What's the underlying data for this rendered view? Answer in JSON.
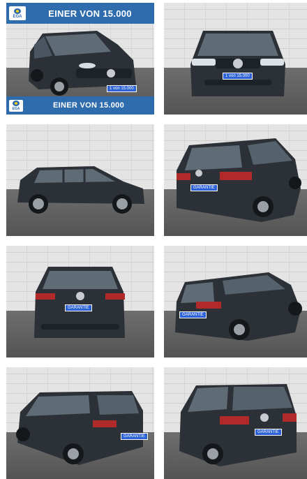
{
  "gallery": {
    "banner_top": "EINER VON 15.000",
    "banner_bottom": "EINER VON 15.000",
    "badge": "EGA",
    "plate_front": "1 von 15.000",
    "plate_rear": "GARANTIE",
    "colors": {
      "banner": "#2f6cae",
      "car_body": "#2c3138",
      "plate": "#2d62d6"
    },
    "photos": [
      {
        "view": "front-three-quarter-left"
      },
      {
        "view": "front"
      },
      {
        "view": "side-right"
      },
      {
        "view": "rear-three-quarter-left"
      },
      {
        "view": "rear"
      },
      {
        "view": "rear-three-quarter-left-wide"
      },
      {
        "view": "rear-three-quarter-right"
      },
      {
        "view": "rear-three-quarter-left-close"
      }
    ]
  }
}
